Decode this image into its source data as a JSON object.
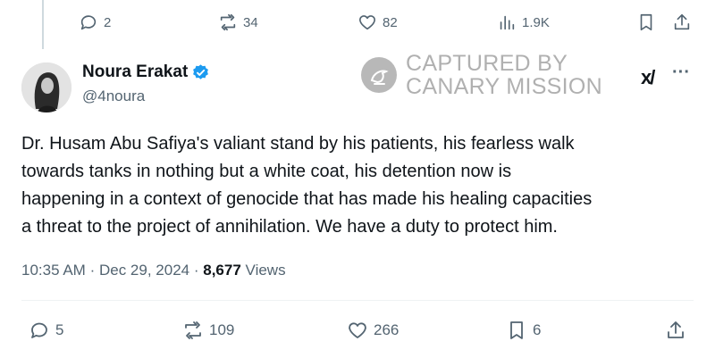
{
  "prev_tweet_actions": {
    "replies": "2",
    "reposts": "34",
    "likes": "82",
    "views": "1.9K"
  },
  "author": {
    "display_name": "Noura Erakat",
    "handle": "@4noura",
    "verified": true
  },
  "watermark": {
    "line1": "CAPTURED BY",
    "line2": "CANARY MISSION"
  },
  "tweet": {
    "lines": [
      "Dr. Husam Abu Safiya's valiant stand by his patients, his fearless walk",
      "towards tanks in nothing but a white coat, his detention now is",
      "happening in a context of genocide that has made his healing capacities",
      "a threat to the project of annihilation. We have a duty to protect him."
    ],
    "time": "10:35 AM",
    "date": "Dec 29, 2024",
    "separator": "·",
    "views_count": "8,677",
    "views_label": "Views"
  },
  "actions": {
    "replies": "5",
    "reposts": "109",
    "likes": "266",
    "bookmarks": "6"
  },
  "icons": {
    "grok": "grok-icon",
    "more": "more-icon"
  },
  "colors": {
    "text": "#0f1419",
    "secondary": "#536471",
    "verified": "#1d9bf0",
    "watermark": "#7d7d7d"
  }
}
